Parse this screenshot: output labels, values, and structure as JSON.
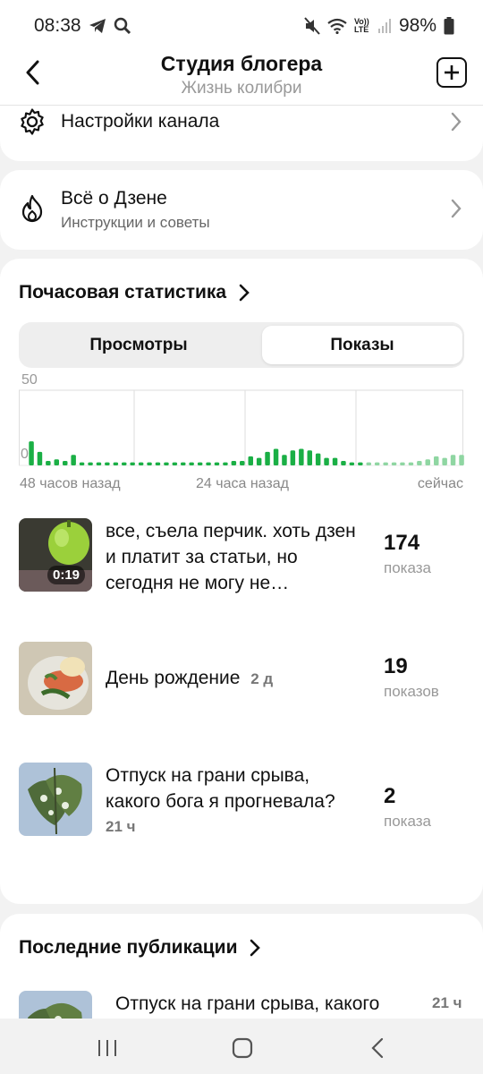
{
  "status": {
    "time": "08:38",
    "battery": "98%",
    "vo_lte": "Vo)) LTE"
  },
  "header": {
    "title": "Студия блогера",
    "subtitle": "Жизнь колибри"
  },
  "settings_row": {
    "label": "Настройки канала"
  },
  "zen_row": {
    "label": "Всё о Дзене",
    "sublabel": "Инструкции и советы"
  },
  "stats": {
    "title": "Почасовая статистика",
    "tabs": [
      {
        "label": "Просмотры",
        "selected": false
      },
      {
        "label": "Показы",
        "selected": true
      }
    ],
    "y_max_label": "50",
    "y_min_label": "0",
    "x_labels": [
      "48 часов назад",
      "24 часа назад",
      "сейчас"
    ]
  },
  "chart_data": {
    "type": "bar",
    "ylim": [
      0,
      50
    ],
    "values": [
      16,
      9,
      3,
      4,
      3,
      7,
      2,
      2,
      2,
      2,
      2,
      2,
      2,
      2,
      2,
      2,
      2,
      2,
      2,
      2,
      2,
      2,
      2,
      2,
      3,
      3,
      6,
      5,
      9,
      11,
      7,
      10,
      11,
      10,
      8,
      5,
      5,
      3,
      2,
      2,
      2,
      2,
      2,
      2,
      2,
      2,
      3,
      4,
      6,
      5,
      7,
      7
    ],
    "colors": {
      "past": "#1aaf45",
      "recent": "#8fd6a2"
    },
    "recent_from_index": 40
  },
  "publications": [
    {
      "title": "все, съела перчик. хоть дзен и платит за статьи, но сегодня не могу не…",
      "duration": "0:19",
      "count": "174",
      "unit": "показа"
    },
    {
      "title": "День рождение",
      "age": "2 д",
      "count": "19",
      "unit": "показов"
    },
    {
      "title": "Отпуск на грани срыва, какого бога я прогневала?",
      "age": "21 ч",
      "count": "2",
      "unit": "показа"
    }
  ],
  "latest": {
    "title": "Последние публикации",
    "item_title": "Отпуск на грани срыва, какого",
    "item_age": "21 ч"
  }
}
